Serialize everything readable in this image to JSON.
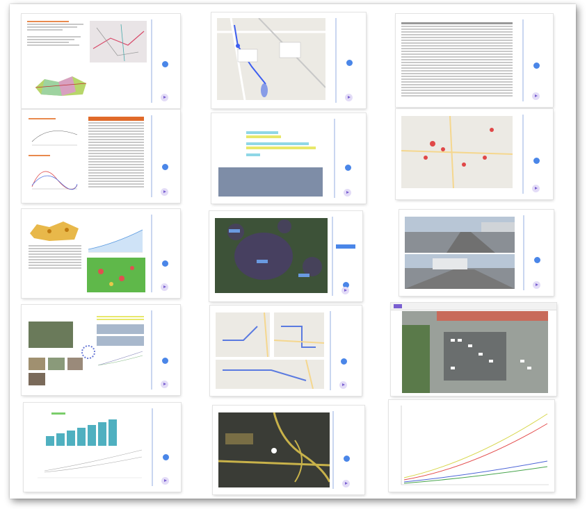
{
  "window": {
    "title": ""
  },
  "slides": [
    {
      "id": "s1",
      "title": "",
      "subtitle": ""
    },
    {
      "id": "s2",
      "title": "",
      "subtitle": ""
    },
    {
      "id": "s3",
      "title": "",
      "subtitle": ""
    },
    {
      "id": "s4",
      "title": "",
      "subtitle": ""
    },
    {
      "id": "s5",
      "title": "",
      "subtitle": ""
    },
    {
      "id": "s6",
      "title": "",
      "subtitle": ""
    },
    {
      "id": "s7",
      "title": "",
      "subtitle": ""
    },
    {
      "id": "s8",
      "title": "",
      "subtitle": ""
    },
    {
      "id": "s9",
      "title": "",
      "subtitle": ""
    },
    {
      "id": "s10",
      "title": "",
      "subtitle": ""
    },
    {
      "id": "s11",
      "title": "",
      "subtitle": ""
    },
    {
      "id": "s12",
      "title": "",
      "subtitle": ""
    },
    {
      "id": "s13",
      "title": "",
      "subtitle": ""
    },
    {
      "id": "s14",
      "title": "",
      "subtitle": ""
    },
    {
      "id": "s15",
      "title": "",
      "subtitle": ""
    }
  ],
  "colors": {
    "accent_blue": "#4a86e8",
    "nav_purple": "#7a5fd1",
    "rail_line": "#c9d6f0",
    "curve_yellow": "#d7d64a",
    "curve_red": "#e34b4b",
    "curve_blue": "#4a62d6",
    "curve_green": "#45a34a",
    "bar_teal": "#4fb0c0"
  }
}
